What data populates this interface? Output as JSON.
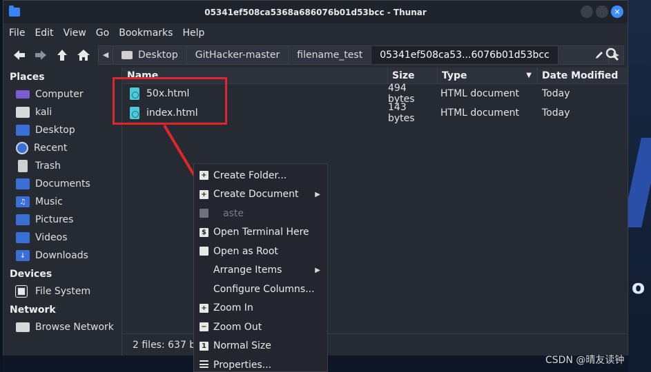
{
  "window": {
    "title": "05341ef508ca5368a686076b01d53bcc - Thunar"
  },
  "menubar": [
    "File",
    "Edit",
    "View",
    "Go",
    "Bookmarks",
    "Help"
  ],
  "breadcrumbs": [
    "Desktop",
    "GitHacker-master",
    "filename_test",
    "05341ef508ca53...6076b01d53bcc"
  ],
  "sidebar": {
    "places_title": "Places",
    "places": [
      {
        "label": "Computer",
        "icon": "computer-icon"
      },
      {
        "label": "kali",
        "icon": "home-icon"
      },
      {
        "label": "Desktop",
        "icon": "desktop-folder-icon"
      },
      {
        "label": "Recent",
        "icon": "recent-icon"
      },
      {
        "label": "Trash",
        "icon": "trash-icon"
      },
      {
        "label": "Documents",
        "icon": "documents-folder-icon"
      },
      {
        "label": "Music",
        "icon": "music-folder-icon"
      },
      {
        "label": "Pictures",
        "icon": "pictures-folder-icon"
      },
      {
        "label": "Videos",
        "icon": "videos-folder-icon"
      },
      {
        "label": "Downloads",
        "icon": "downloads-folder-icon"
      }
    ],
    "devices_title": "Devices",
    "devices": [
      {
        "label": "File System",
        "icon": "filesystem-icon"
      }
    ],
    "network_title": "Network",
    "network": [
      {
        "label": "Browse Network",
        "icon": "network-icon"
      }
    ]
  },
  "columns": {
    "name": "Name",
    "size": "Size",
    "type": "Type",
    "date": "Date Modified"
  },
  "files": [
    {
      "name": "50x.html",
      "size": "494 bytes",
      "type": "HTML document",
      "date": "Today"
    },
    {
      "name": "index.html",
      "size": "143 bytes",
      "type": "HTML document",
      "date": "Today"
    }
  ],
  "status": "2 files: 637 by",
  "context_menu": [
    {
      "label": "Create Folder...",
      "icon": "plus",
      "submenu": false,
      "disabled": false
    },
    {
      "label": "Create Document",
      "icon": "doc",
      "submenu": true,
      "disabled": false
    },
    {
      "label": "aste",
      "icon": "paste",
      "submenu": false,
      "disabled": true
    },
    {
      "label": "Open Terminal Here",
      "icon": "terminal",
      "submenu": false,
      "disabled": false
    },
    {
      "label": "Open as Root",
      "icon": "folder",
      "submenu": false,
      "disabled": false
    },
    {
      "label": "Arrange Items",
      "icon": "",
      "submenu": true,
      "disabled": false
    },
    {
      "label": "Configure Columns...",
      "icon": "",
      "submenu": false,
      "disabled": false
    },
    {
      "label": "Zoom In",
      "icon": "plus",
      "submenu": false,
      "disabled": false
    },
    {
      "label": "Zoom Out",
      "icon": "minus",
      "submenu": false,
      "disabled": false
    },
    {
      "label": "Normal Size",
      "icon": "one",
      "submenu": false,
      "disabled": false
    },
    {
      "label": "Properties...",
      "icon": "lines",
      "submenu": false,
      "disabled": false
    }
  ],
  "watermark": "CSDN @晴友读钟",
  "colors": {
    "accent": "#3b82f6",
    "annotation": "#e0262b",
    "window_bg": "#262a33"
  }
}
